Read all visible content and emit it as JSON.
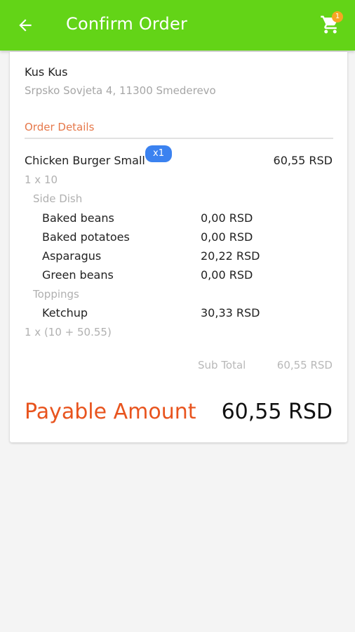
{
  "header": {
    "title": "Confirm Order",
    "cart_count": "1",
    "bar_color": "#63d417"
  },
  "restaurant": {
    "name": "Kus Kus",
    "address": "Srpsko Sovjeta 4, 11300 Smederevo"
  },
  "order": {
    "section_title": "Order Details",
    "item": {
      "name": "Chicken Burger Small",
      "qty_badge": "x1",
      "price": "60,55 RSD",
      "unit_line": "1 x 10",
      "calc_line": "1 x (10 + 50.55)"
    },
    "groups": [
      {
        "label": "Side Dish",
        "options": [
          {
            "name": "Baked beans",
            "price": "0,00 RSD"
          },
          {
            "name": "Baked potatoes",
            "price": "0,00 RSD"
          },
          {
            "name": "Asparagus",
            "price": "20,22 RSD"
          },
          {
            "name": "Green beans",
            "price": "0,00 RSD"
          }
        ]
      },
      {
        "label": "Toppings",
        "options": [
          {
            "name": "Ketchup",
            "price": "30,33 RSD"
          }
        ]
      }
    ],
    "subtotal_label": "Sub Total",
    "subtotal_value": "60,55 RSD",
    "payable_label": "Payable Amount",
    "payable_value": "60,55 RSD"
  },
  "colors": {
    "accent": "#e8541e",
    "section": "#e6784a",
    "badge": "#3b82f0",
    "cart_badge": "#f5a623"
  }
}
